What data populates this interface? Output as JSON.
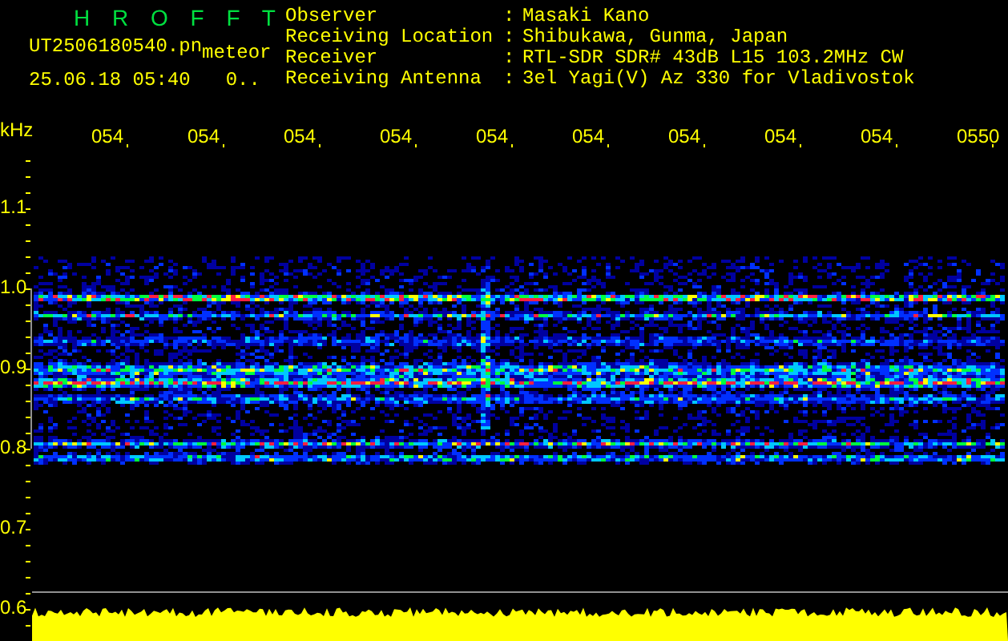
{
  "header": {
    "title": "H R O F F T",
    "filename": "UT2506180540.pn",
    "file_tag": "meteor",
    "datetime": "25.06.18 05:40",
    "count": "0.."
  },
  "info": [
    {
      "label": "Observer",
      "separator": ":",
      "value": "Masaki Kano"
    },
    {
      "label": "Receiving Location",
      "separator": ":",
      "value": "Shibukawa, Gunma, Japan"
    },
    {
      "label": "Receiver",
      "separator": ":",
      "value": "RTL-SDR SDR# 43dB L15 103.2MHz CW"
    },
    {
      "label": "Receiving Antenna",
      "separator": ":",
      "value": "3el Yagi(V) Az 330 for Vladivostok"
    }
  ],
  "plot": {
    "unit": "kHz",
    "time_labels": [
      "054",
      "054",
      "054",
      "054",
      "054",
      "054",
      "054",
      "054",
      "054",
      "0550"
    ],
    "freq_labels": [
      "1.1",
      "1.0",
      "0.9",
      "0.8",
      "0.7",
      "0.6"
    ]
  }
}
